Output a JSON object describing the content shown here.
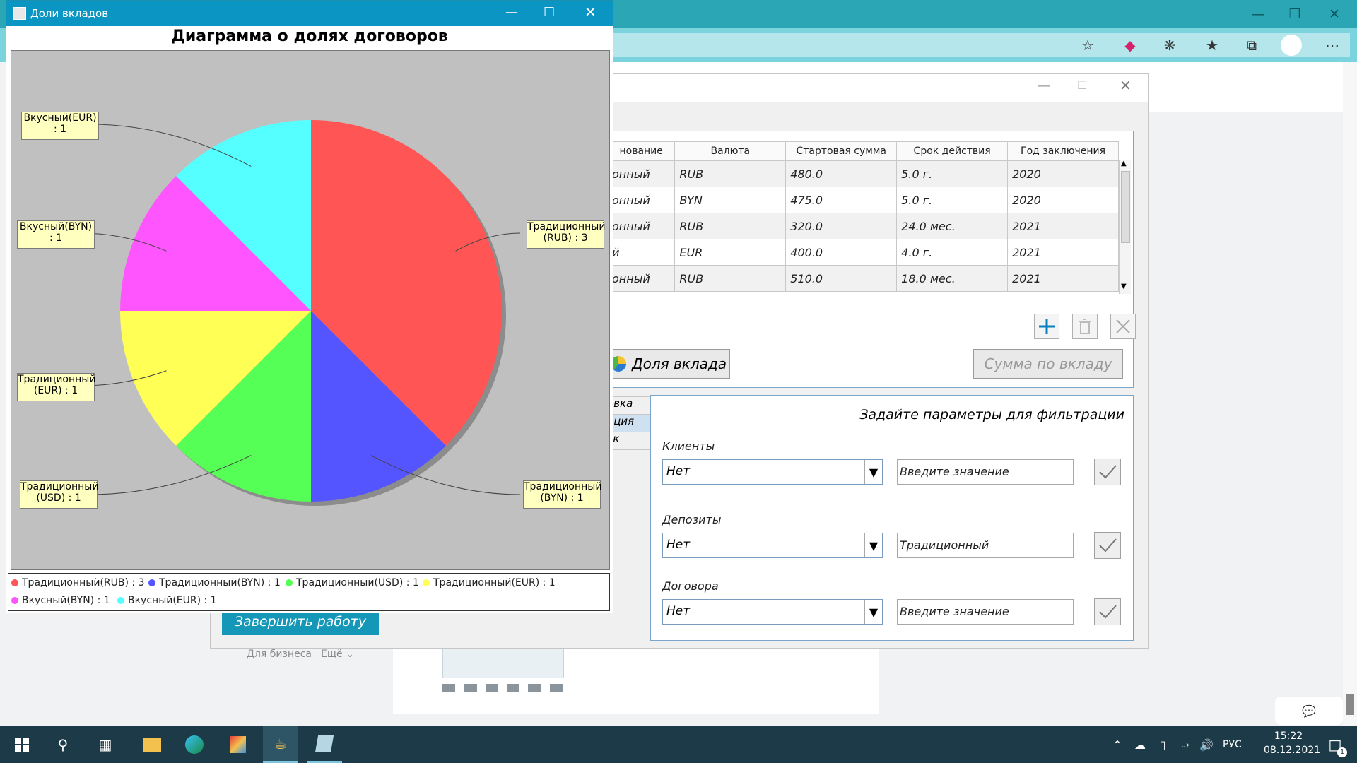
{
  "chart_window": {
    "title": "Доли вкладов",
    "chart_title": "Диаграмма о долях договоров"
  },
  "chart_data": {
    "type": "pie",
    "title": "Диаграмма о долях договоров",
    "slices": [
      {
        "name": "Традиционный(RUB)",
        "value": 3,
        "color": "#ff5555",
        "label": "Традиционный\n(RUB) : 3"
      },
      {
        "name": "Традиционный(BYN)",
        "value": 1,
        "color": "#5555ff",
        "label": "Традиционный\n(BYN) : 1"
      },
      {
        "name": "Традиционный(USD)",
        "value": 1,
        "color": "#55ff55",
        "label": "Традиционный\n(USD) : 1"
      },
      {
        "name": "Традиционный(EUR)",
        "value": 1,
        "color": "#ffff55",
        "label": "Традиционный\n(EUR) : 1"
      },
      {
        "name": "Вкусный(BYN)",
        "value": 1,
        "color": "#ff55ff",
        "label": "Вкусный(BYN)\n: 1"
      },
      {
        "name": "Вкусный(EUR)",
        "value": 1,
        "color": "#55ffff",
        "label": "Вкусный(EUR)\n: 1"
      }
    ],
    "legend": [
      "Традиционный(RUB) : 3",
      "Традиционный(BYN) : 1",
      "Традиционный(USD) : 1",
      "Традиционный(EUR) : 1",
      "Вкусный(BYN) : 1",
      "Вкусный(EUR) : 1"
    ],
    "legend_position": "bottom"
  },
  "main_window": {
    "table": {
      "headers": [
        "нование",
        "Валюта",
        "Стартовая сумма",
        "Срок действия",
        "Год заключения"
      ],
      "rows": [
        [
          "онный",
          "RUB",
          "480.0",
          "5.0 г.",
          "2020"
        ],
        [
          "онный",
          "BYN",
          "475.0",
          "5.0 г.",
          "2020"
        ],
        [
          "онный",
          "RUB",
          "320.0",
          "24.0 мес.",
          "2021"
        ],
        [
          "й",
          "EUR",
          "400.0",
          "4.0 г.",
          "2021"
        ],
        [
          "онный",
          "RUB",
          "510.0",
          "18.0 мес.",
          "2021"
        ]
      ]
    },
    "share_button": "Доля вклада",
    "sum_button": "Сумма по вкладу",
    "side_tabs": [
      "овка",
      "ация",
      "ск"
    ],
    "filter": {
      "title": "Задайте параметры для фильтрации",
      "clients_label": "Клиенты",
      "clients_combo": "Нет",
      "clients_input_placeholder": "Введите значение",
      "deposits_label": "Депозиты",
      "deposits_combo": "Нет",
      "deposits_input_value": "Традиционный",
      "contracts_label": "Договора",
      "contracts_combo": "Нет",
      "contracts_input_placeholder": "Введите значение"
    },
    "finish_button": "Завершить работу"
  },
  "webpage": {
    "for_business": "Для бизнеса",
    "more": "Ещё"
  },
  "taskbar": {
    "language": "РУС",
    "time": "15:22",
    "date": "08.12.2021",
    "notification_count": "1"
  }
}
